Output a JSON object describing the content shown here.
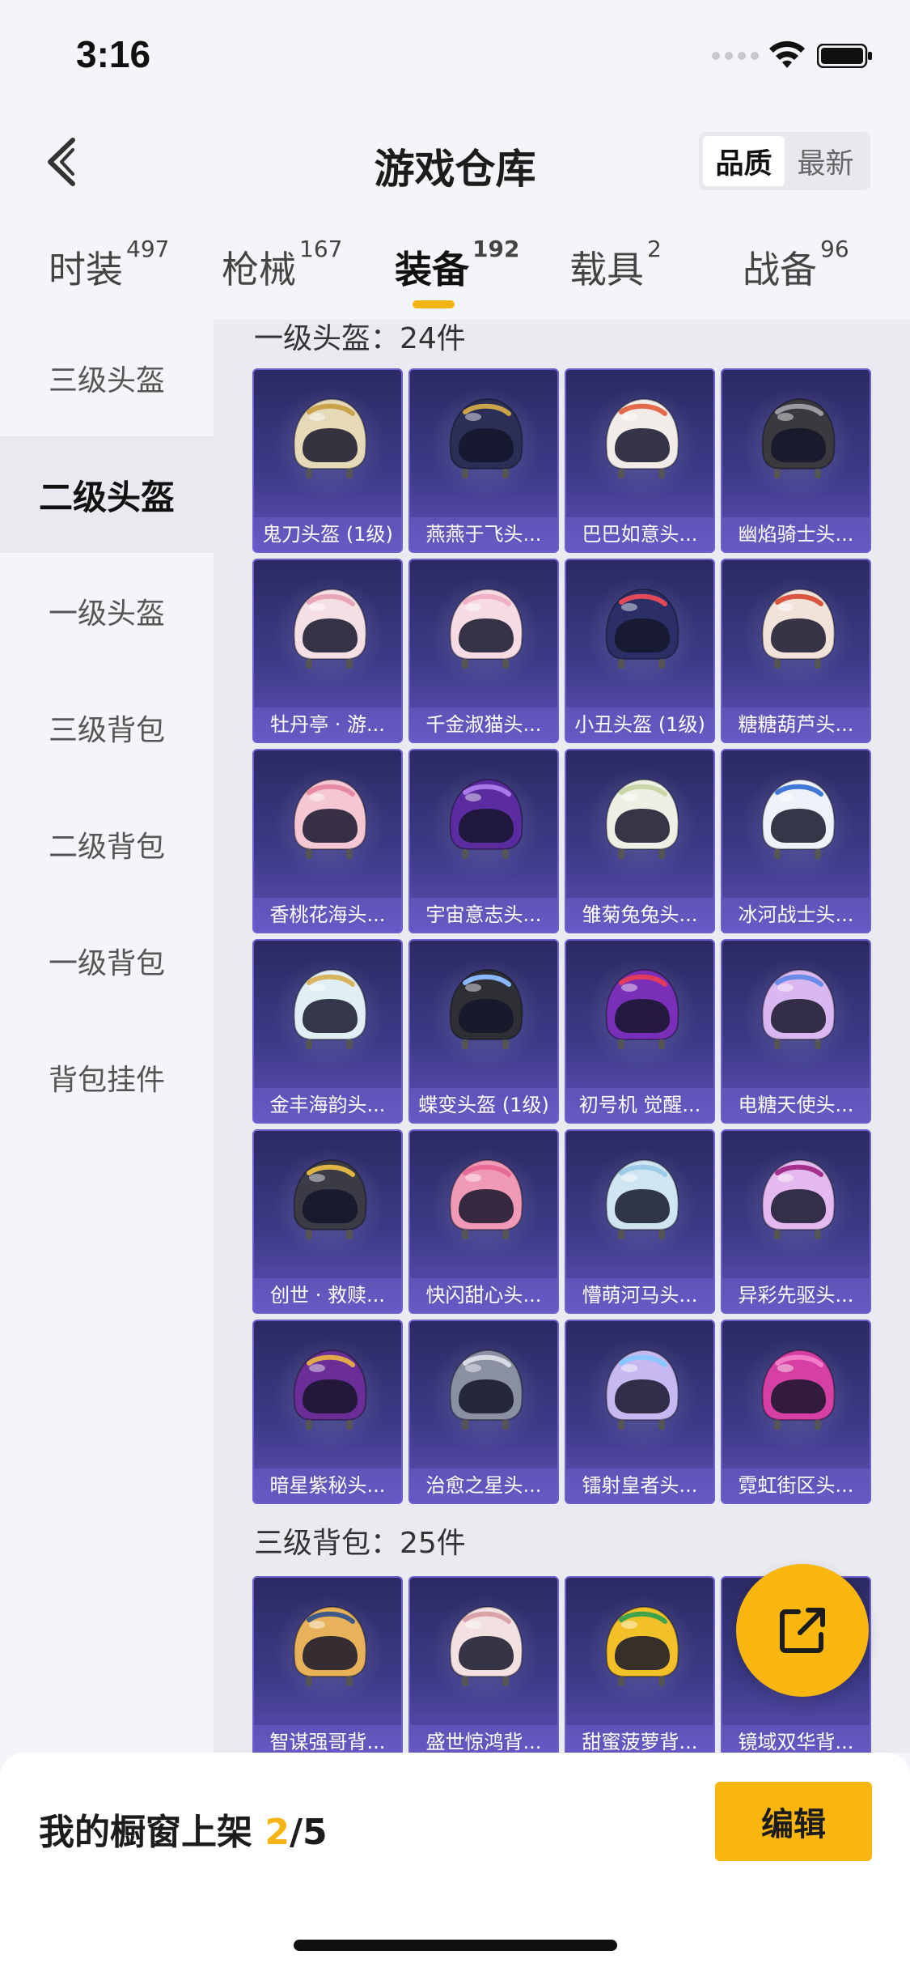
{
  "status": {
    "time": "3:16"
  },
  "header": {
    "title": "游戏仓库",
    "sort_options": [
      {
        "label": "品质",
        "active": true
      },
      {
        "label": "最新",
        "active": false
      }
    ]
  },
  "tabs": [
    {
      "label": "时装",
      "count": "497",
      "active": false
    },
    {
      "label": "枪械",
      "count": "167",
      "active": false
    },
    {
      "label": "装备",
      "count": "192",
      "active": true
    },
    {
      "label": "载具",
      "count": "2",
      "active": false
    },
    {
      "label": "战备",
      "count": "96",
      "active": false
    }
  ],
  "sidebar": {
    "items": [
      {
        "label": "三级头盔",
        "active": false
      },
      {
        "label": "二级头盔",
        "active": true
      },
      {
        "label": "一级头盔",
        "active": false
      },
      {
        "label": "三级背包",
        "active": false
      },
      {
        "label": "二级背包",
        "active": false
      },
      {
        "label": "一级背包",
        "active": false
      },
      {
        "label": "背包挂件",
        "active": false
      }
    ]
  },
  "sections": [
    {
      "title": "一级头盔：24件",
      "items": [
        {
          "name": "鬼刀头盔 (1级)",
          "color": "#e6d9b8",
          "accent": "#c9a24a"
        },
        {
          "name": "燕燕于飞头...",
          "color": "#2c2f55",
          "accent": "#c9a24a"
        },
        {
          "name": "巴巴如意头...",
          "color": "#f1ece8",
          "accent": "#e46a4a"
        },
        {
          "name": "幽焰骑士头...",
          "color": "#3a3a3e",
          "accent": "#9a9aa0"
        },
        {
          "name": "牡丹亭 · 游...",
          "color": "#f4dfe4",
          "accent": "#e9a5b8"
        },
        {
          "name": "千金淑猫头...",
          "color": "#f6dbe4",
          "accent": "#f0b0c6"
        },
        {
          "name": "小丑头盔 (1级)",
          "color": "#2b2f66",
          "accent": "#e24a5a"
        },
        {
          "name": "糖糖葫芦头...",
          "color": "#f1e2da",
          "accent": "#d9553f"
        },
        {
          "name": "香桃花海头...",
          "color": "#f4c7d3",
          "accent": "#e88aa4"
        },
        {
          "name": "宇宙意志头...",
          "color": "#5a2ca0",
          "accent": "#a779e9"
        },
        {
          "name": "雏菊兔兔头...",
          "color": "#eef0e6",
          "accent": "#c9d7a6"
        },
        {
          "name": "冰河战士头...",
          "color": "#eef2f8",
          "accent": "#3f78d6"
        },
        {
          "name": "金丰海韵头...",
          "color": "#e1eef6",
          "accent": "#d9b45f"
        },
        {
          "name": "蝶变头盔 (1级)",
          "color": "#2e2f35",
          "accent": "#8ab8ff"
        },
        {
          "name": "初号机 觉醒...",
          "color": "#7a2fb8",
          "accent": "#e23b5d"
        },
        {
          "name": "电糖天使头...",
          "color": "#d9b7f0",
          "accent": "#6a8bea"
        },
        {
          "name": "创世 · 救赎...",
          "color": "#3a3b44",
          "accent": "#e0b545"
        },
        {
          "name": "快闪甜心头...",
          "color": "#f19ab8",
          "accent": "#e86a96"
        },
        {
          "name": "懵萌河马头...",
          "color": "#cfe6f2",
          "accent": "#9ccbe6"
        },
        {
          "name": "异彩先驱头...",
          "color": "#e3b9f0",
          "accent": "#a32e8c"
        },
        {
          "name": "暗星紫秘头...",
          "color": "#6a2e96",
          "accent": "#e2a94a"
        },
        {
          "name": "治愈之星头...",
          "color": "#8b8fa2",
          "accent": "#d9dbe4"
        },
        {
          "name": "镭射皇者头...",
          "color": "#c6b8f0",
          "accent": "#8ac6ff"
        },
        {
          "name": "霓虹街区头...",
          "color": "#d63fa3",
          "accent": "#f27ac6"
        }
      ]
    },
    {
      "title": "三级背包：25件",
      "items": [
        {
          "name": "智谋强哥背...",
          "color": "#e7b25a",
          "accent": "#3f5a8a"
        },
        {
          "name": "盛世惊鸿背...",
          "color": "#f3e0e0",
          "accent": "#d9a3a8"
        },
        {
          "name": "甜蜜菠萝背...",
          "color": "#f2c12a",
          "accent": "#3fa34d"
        },
        {
          "name": "镜域双华背...",
          "color": "#9aa3c8",
          "accent": "#e0c37a"
        }
      ]
    }
  ],
  "bottom": {
    "showcase_label": "我的橱窗上架",
    "showcase_current": "2",
    "showcase_total": "/5",
    "edit_label": "编辑"
  }
}
